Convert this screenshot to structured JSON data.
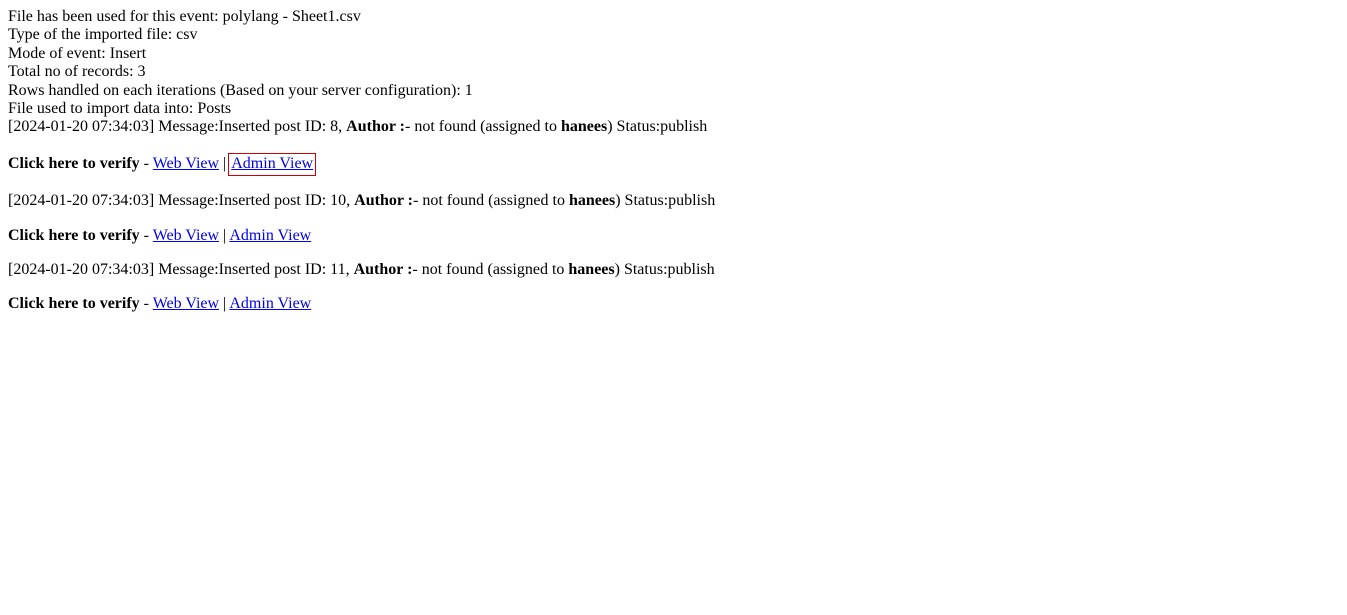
{
  "header": {
    "file_used_label": "File has been used for this event: ",
    "file_used_value": "polylang - Sheet1.csv",
    "type_label": "Type of the imported file: ",
    "type_value": "csv",
    "mode_label": "Mode of event: ",
    "mode_value": "Insert",
    "total_label": "Total no of records: ",
    "total_value": "3",
    "rows_label": "Rows handled on each iterations (Based on your server configuration): ",
    "rows_value": "1",
    "import_into_label": "File used to import data into: ",
    "import_into_value": "Posts"
  },
  "common": {
    "verify_label": "Click here to verify",
    "dash": " - ",
    "pipe": " | ",
    "web_view": "Web View",
    "admin_view": "Admin View",
    "msg_prefix": "Message:Inserted post ID: ",
    "author_label": "Author :",
    "not_found_prefix": "- not found (assigned to ",
    "assigned_user": "hanees",
    "not_found_suffix": ") Status:publish"
  },
  "entries": [
    {
      "timestamp": "[2024-01-20 07:34:03] ",
      "post_id": "8, ",
      "highlight_admin": true
    },
    {
      "timestamp": "[2024-01-20 07:34:03] ",
      "post_id": "10, ",
      "highlight_admin": false
    },
    {
      "timestamp": "[2024-01-20 07:34:03] ",
      "post_id": "11, ",
      "highlight_admin": false
    }
  ]
}
